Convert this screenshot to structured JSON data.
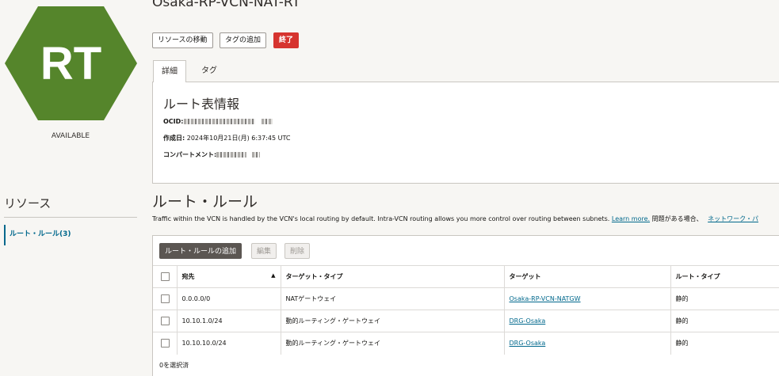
{
  "resource": {
    "icon_text": "RT",
    "icon_color": "#55852b",
    "status": "AVAILABLE",
    "title": "Osaka-RP-VCN-NAT-RT"
  },
  "actions": {
    "move": "リソースの移動",
    "add_tag": "タグの追加",
    "terminate": "終了"
  },
  "tabs": [
    {
      "label": "詳細"
    },
    {
      "label": "タグ"
    }
  ],
  "info": {
    "title": "ルート表情報",
    "ocid_label": "OCID:",
    "created_label": "作成日:",
    "created_value": "2024年10月21日(月) 6:37:45 UTC",
    "compartment_label": "コンパートメント:"
  },
  "sidebar": {
    "title": "リソース",
    "items": [
      {
        "label": "ルート・ルール(3)"
      }
    ]
  },
  "route_rules": {
    "title": "ルート・ルール",
    "description": "Traffic within the VCN is handled by the VCN's local routing by default. Intra-VCN routing allows you more control over routing between subnets.",
    "learn_more": "Learn more.",
    "help_text": "問題がある場合、",
    "network_link": "ネットワーク・パ",
    "buttons": {
      "add": "ルート・ルールの追加",
      "edit": "編集",
      "delete": "削除"
    },
    "columns": [
      "宛先",
      "ターゲット・タイプ",
      "ターゲット",
      "ルート・タイプ"
    ],
    "rows": [
      {
        "dest": "0.0.0.0/0",
        "target_type": "NATゲートウェイ",
        "target": "Osaka-RP-VCN-NATGW",
        "route_type": "静的"
      },
      {
        "dest": "10.10.1.0/24",
        "target_type": "動的ルーティング・ゲートウェイ",
        "target": "DRG-Osaka",
        "route_type": "静的"
      },
      {
        "dest": "10.10.10.0/24",
        "target_type": "動的ルーティング・ゲートウェイ",
        "target": "DRG-Osaka",
        "route_type": "静的"
      }
    ],
    "selected": "0を選択済"
  }
}
